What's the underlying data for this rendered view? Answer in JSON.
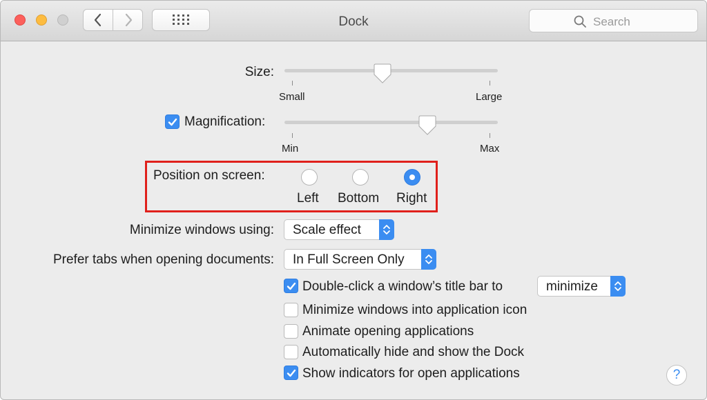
{
  "window": {
    "title": "Dock",
    "search_placeholder": "Search"
  },
  "size": {
    "label": "Size:",
    "min_label": "Small",
    "max_label": "Large",
    "value": 0.46
  },
  "magnification": {
    "label": "Magnification:",
    "enabled": true,
    "min_label": "Min",
    "max_label": "Max",
    "value": 0.67
  },
  "position": {
    "label": "Position on screen:",
    "options": [
      {
        "label": "Left",
        "selected": false
      },
      {
        "label": "Bottom",
        "selected": false
      },
      {
        "label": "Right",
        "selected": true
      }
    ]
  },
  "minimize": {
    "label": "Minimize windows using:",
    "value": "Scale effect"
  },
  "prefer_tabs": {
    "label": "Prefer tabs when opening documents:",
    "value": "In Full Screen Only"
  },
  "double_click": {
    "label": "Double-click a window’s title bar to",
    "checked": true,
    "value": "minimize"
  },
  "checkboxes": [
    {
      "label": "Minimize windows into application icon",
      "checked": false
    },
    {
      "label": "Animate opening applications",
      "checked": false
    },
    {
      "label": "Automatically hide and show the Dock",
      "checked": false
    },
    {
      "label": "Show indicators for open applications",
      "checked": true
    }
  ],
  "help": {
    "label": "?"
  },
  "colors": {
    "accent": "#3b8df1",
    "highlight": "#e0201b"
  }
}
